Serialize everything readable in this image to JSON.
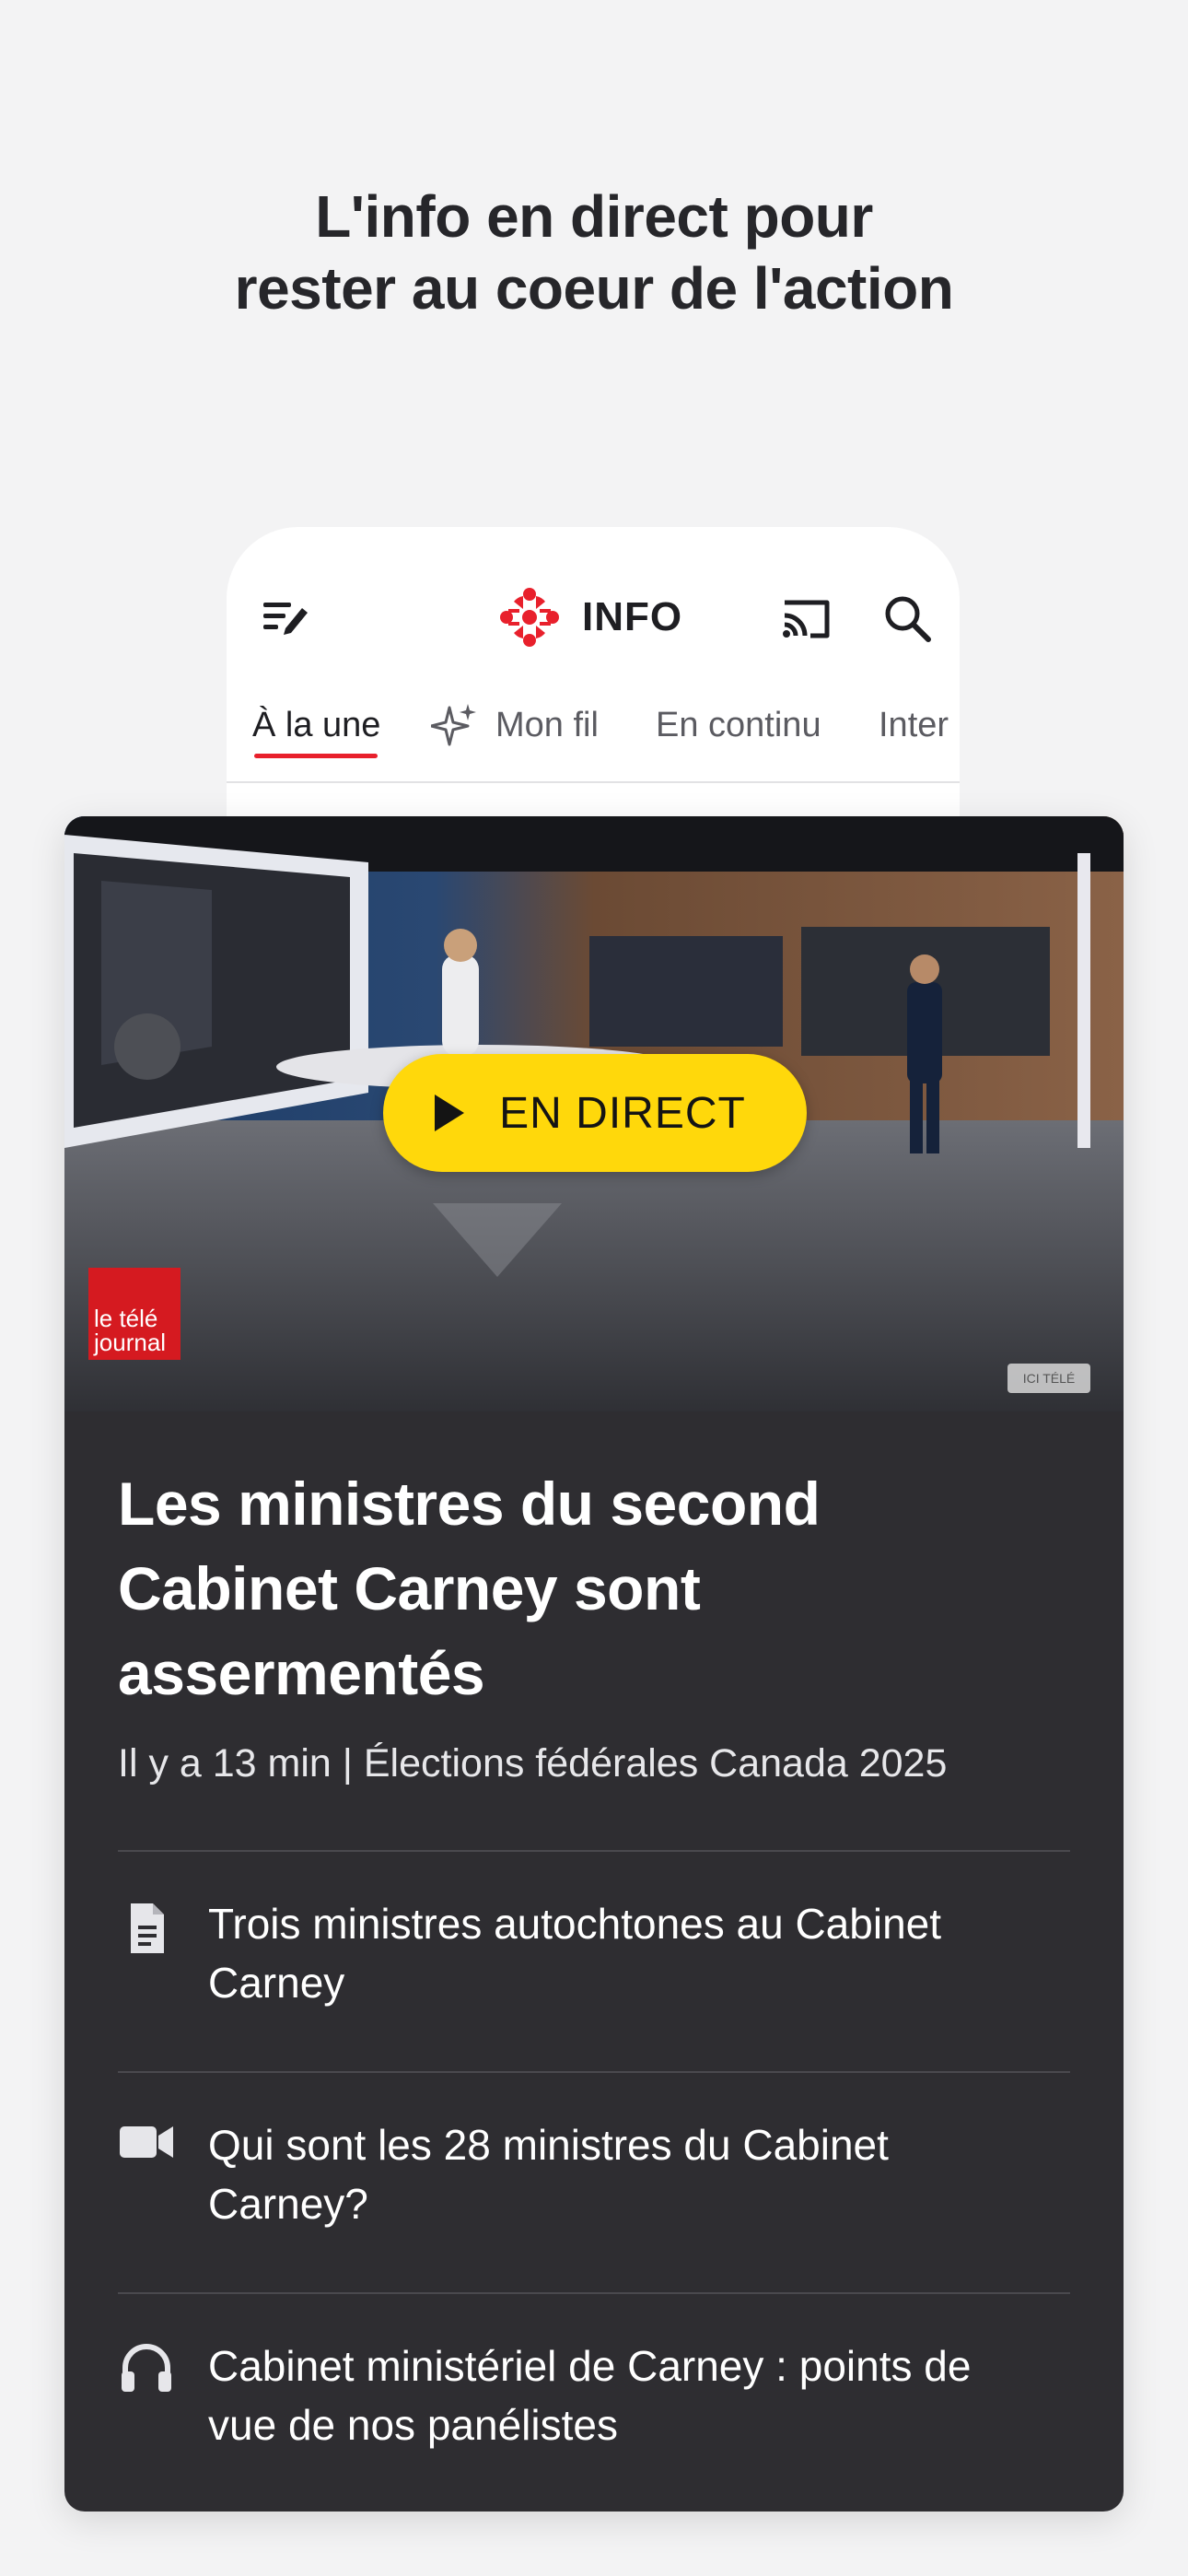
{
  "promo": {
    "headline_line1": "L'info en direct pour",
    "headline_line2": "rester au coeur de l'action"
  },
  "app_bar": {
    "menu_icon": "menu-edit-icon",
    "logo_icon": "radio-canada-gem-icon",
    "brand_text": "INFO",
    "cast_icon": "cast-icon",
    "search_icon": "search-icon",
    "accent_color": "#e8202c"
  },
  "tabs": [
    {
      "label": "À la une",
      "active": true
    },
    {
      "label": "Mon fil",
      "icon": "sparkle-icon",
      "active": false
    },
    {
      "label": "En continu",
      "active": false
    },
    {
      "label": "Inter",
      "active": false
    }
  ],
  "video": {
    "live_label": "EN DIRECT",
    "live_button_color": "#ffd80b",
    "channel_logo_line1": "le télé",
    "channel_logo_line2": "journal",
    "network_badge": "ICI TÉLÉ"
  },
  "article": {
    "title_line1": "Les ministres du second",
    "title_line2": "Cabinet Carney sont",
    "title_line3": "assermentés",
    "meta": "Il y a 13 min | Élections fédérales Canada 2025"
  },
  "related": [
    {
      "icon": "document-icon",
      "line1": "Trois ministres autochtones au Cabinet",
      "line2": "Carney"
    },
    {
      "icon": "video-camera-icon",
      "line1": "Qui sont les 28 ministres du Cabinet",
      "line2": "Carney?"
    },
    {
      "icon": "headphones-icon",
      "line1": "Cabinet ministériel de Carney : points de",
      "line2": "vue de nos panélistes"
    }
  ]
}
